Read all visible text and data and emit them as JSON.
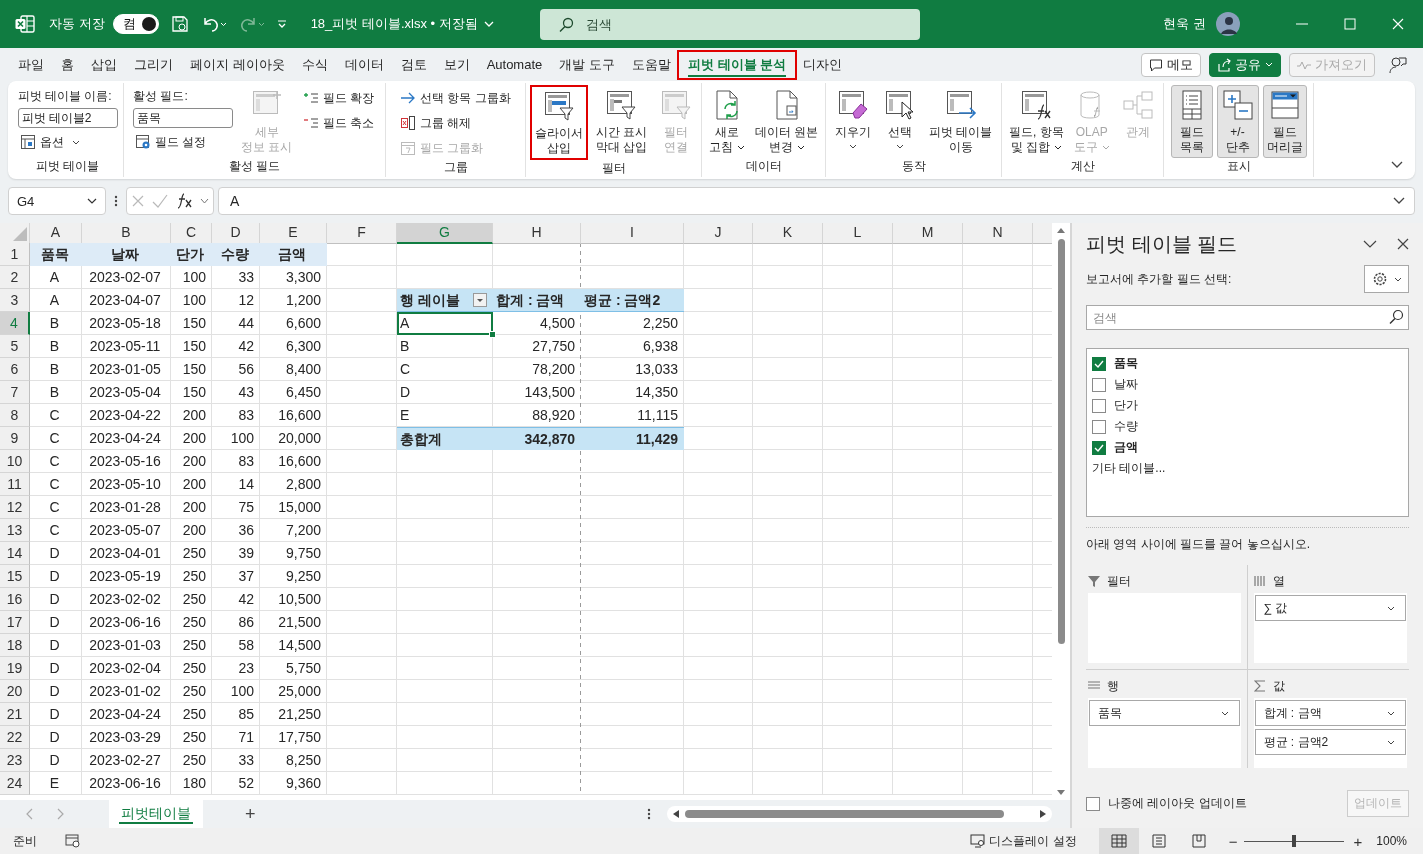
{
  "window": {
    "autosave_label": "자동 저장",
    "autosave": {
      "on": true,
      "label": "켬"
    },
    "title": "18_피벗 테이블.xlsx • 저장됨",
    "search_placeholder": "검색",
    "user_name": "현욱 권"
  },
  "menu_tabs": [
    {
      "label": "파일",
      "selected": false,
      "highlighted": false
    },
    {
      "label": "홈",
      "selected": false,
      "highlighted": false
    },
    {
      "label": "삽입",
      "selected": false,
      "highlighted": false
    },
    {
      "label": "그리기",
      "selected": false,
      "highlighted": false
    },
    {
      "label": "페이지 레이아웃",
      "selected": false,
      "highlighted": false
    },
    {
      "label": "수식",
      "selected": false,
      "highlighted": false
    },
    {
      "label": "데이터",
      "selected": false,
      "highlighted": false
    },
    {
      "label": "검토",
      "selected": false,
      "highlighted": false
    },
    {
      "label": "보기",
      "selected": false,
      "highlighted": false
    },
    {
      "label": "Automate",
      "selected": false,
      "highlighted": false
    },
    {
      "label": "개발 도구",
      "selected": false,
      "highlighted": false
    },
    {
      "label": "도움말",
      "selected": false,
      "highlighted": false
    },
    {
      "label": "피벗 테이블 분석",
      "selected": true,
      "highlighted": true
    },
    {
      "label": "디자인",
      "selected": false,
      "highlighted": false
    }
  ],
  "menu_buttons": [
    {
      "kind": "comments",
      "label": "메모",
      "disabled": false
    },
    {
      "kind": "share",
      "label": "공유",
      "disabled": false
    },
    {
      "kind": "catchup",
      "label": "가져오기",
      "disabled": true
    }
  ],
  "ribbon": [
    {
      "label": "피벗 테이블",
      "controls": [
        {
          "kind": "caption",
          "label": "피벗 테이블 이름:"
        },
        {
          "kind": "input",
          "value": "피벗 테이블2"
        },
        {
          "kind": "small",
          "label": "옵션",
          "dropdown": true,
          "disabled": false
        }
      ]
    },
    {
      "label": "활성 필드",
      "controls": [
        {
          "kind": "caption",
          "label": "활성 필드:"
        },
        {
          "kind": "input",
          "value": "품목"
        },
        {
          "kind": "small",
          "label": "필드 설정",
          "dropdown": false,
          "disabled": false
        },
        {
          "kind": "large",
          "lines": [
            "세부",
            "정보 표시"
          ],
          "dropdown": false,
          "disabled": true,
          "highlighted": false,
          "pressed": false
        },
        {
          "kind": "small",
          "label": "필드 확장",
          "dropdown": false,
          "disabled": false
        },
        {
          "kind": "small",
          "label": "필드 축소",
          "dropdown": false,
          "disabled": false
        }
      ]
    },
    {
      "label": "그룹",
      "controls": [
        {
          "kind": "small",
          "label": "선택 항목 그룹화",
          "dropdown": false,
          "disabled": false
        },
        {
          "kind": "small",
          "label": "그룹 해제",
          "dropdown": false,
          "disabled": false
        },
        {
          "kind": "small",
          "label": "필드 그룹화",
          "dropdown": false,
          "disabled": true
        }
      ]
    },
    {
      "label": "필터",
      "controls": [
        {
          "kind": "large",
          "lines": [
            "슬라이서",
            "삽입"
          ],
          "dropdown": false,
          "disabled": false,
          "highlighted": true,
          "pressed": false
        },
        {
          "kind": "large",
          "lines": [
            "시간 표시",
            "막대 삽입"
          ],
          "dropdown": false,
          "disabled": false,
          "highlighted": false,
          "pressed": false
        },
        {
          "kind": "large",
          "lines": [
            "필터",
            "연결"
          ],
          "dropdown": false,
          "disabled": true,
          "highlighted": false,
          "pressed": false
        }
      ]
    },
    {
      "label": "데이터",
      "controls": [
        {
          "kind": "large",
          "lines": [
            "새로",
            "고침"
          ],
          "dropdown": true,
          "disabled": false,
          "highlighted": false,
          "pressed": false
        },
        {
          "kind": "large",
          "lines": [
            "데이터 원본",
            "변경"
          ],
          "dropdown": true,
          "disabled": false,
          "highlighted": false,
          "pressed": false
        }
      ]
    },
    {
      "label": "동작",
      "controls": [
        {
          "kind": "large",
          "lines": [
            "지우기"
          ],
          "dropdown": true,
          "disabled": false,
          "highlighted": false,
          "pressed": false
        },
        {
          "kind": "large",
          "lines": [
            "선택"
          ],
          "dropdown": true,
          "disabled": false,
          "highlighted": false,
          "pressed": false
        },
        {
          "kind": "large",
          "lines": [
            "피벗 테이블",
            "이동"
          ],
          "dropdown": false,
          "disabled": false,
          "highlighted": false,
          "pressed": false
        }
      ]
    },
    {
      "label": "계산",
      "controls": [
        {
          "kind": "large",
          "lines": [
            "필드, 항목",
            "및 집합"
          ],
          "dropdown": true,
          "disabled": false,
          "highlighted": false,
          "pressed": false
        },
        {
          "kind": "large",
          "lines": [
            "OLAP",
            "도구"
          ],
          "dropdown": true,
          "disabled": true,
          "highlighted": false,
          "pressed": false
        },
        {
          "kind": "large",
          "lines": [
            "관계"
          ],
          "dropdown": false,
          "disabled": true,
          "highlighted": false,
          "pressed": false
        }
      ]
    },
    {
      "label": "표시",
      "controls": [
        {
          "kind": "large",
          "lines": [
            "필드",
            "목록"
          ],
          "dropdown": false,
          "disabled": false,
          "highlighted": false,
          "pressed": true
        },
        {
          "kind": "large",
          "lines": [
            "+/-",
            "단추"
          ],
          "dropdown": false,
          "disabled": false,
          "highlighted": false,
          "pressed": true
        },
        {
          "kind": "large",
          "lines": [
            "필드",
            "머리글"
          ],
          "dropdown": false,
          "disabled": false,
          "highlighted": false,
          "pressed": true
        }
      ]
    }
  ],
  "formula_bar": {
    "name_box": "G4",
    "formula": "A"
  },
  "sheet": {
    "column_headers": [
      {
        "label": "A",
        "selected": false
      },
      {
        "label": "B",
        "selected": false
      },
      {
        "label": "C",
        "selected": false
      },
      {
        "label": "D",
        "selected": false
      },
      {
        "label": "E",
        "selected": false
      },
      {
        "label": "F",
        "selected": false
      },
      {
        "label": "G",
        "selected": true
      },
      {
        "label": "H",
        "selected": false
      },
      {
        "label": "I",
        "selected": false
      },
      {
        "label": "J",
        "selected": false
      },
      {
        "label": "K",
        "selected": false
      },
      {
        "label": "L",
        "selected": false
      },
      {
        "label": "M",
        "selected": false
      },
      {
        "label": "N",
        "selected": false
      }
    ],
    "row_numbers": [
      {
        "label": "1",
        "selected": false
      },
      {
        "label": "2",
        "selected": false
      },
      {
        "label": "3",
        "selected": false
      },
      {
        "label": "4",
        "selected": true
      },
      {
        "label": "5",
        "selected": false
      },
      {
        "label": "6",
        "selected": false
      },
      {
        "label": "7",
        "selected": false
      },
      {
        "label": "8",
        "selected": false
      },
      {
        "label": "9",
        "selected": false
      },
      {
        "label": "10",
        "selected": false
      },
      {
        "label": "11",
        "selected": false
      },
      {
        "label": "12",
        "selected": false
      },
      {
        "label": "13",
        "selected": false
      },
      {
        "label": "14",
        "selected": false
      },
      {
        "label": "15",
        "selected": false
      },
      {
        "label": "16",
        "selected": false
      },
      {
        "label": "17",
        "selected": false
      },
      {
        "label": "18",
        "selected": false
      },
      {
        "label": "19",
        "selected": false
      },
      {
        "label": "20",
        "selected": false
      },
      {
        "label": "21",
        "selected": false
      },
      {
        "label": "22",
        "selected": false
      },
      {
        "label": "23",
        "selected": false
      },
      {
        "label": "24",
        "selected": false
      }
    ]
  },
  "data_table": {
    "header": [
      "품목",
      "날짜",
      "단가",
      "수량",
      "금액"
    ],
    "rows": [
      [
        "A",
        "2023-02-07",
        "100",
        "33",
        "3,300"
      ],
      [
        "A",
        "2023-04-07",
        "100",
        "12",
        "1,200"
      ],
      [
        "B",
        "2023-05-18",
        "150",
        "44",
        "6,600"
      ],
      [
        "B",
        "2023-05-11",
        "150",
        "42",
        "6,300"
      ],
      [
        "B",
        "2023-01-05",
        "150",
        "56",
        "8,400"
      ],
      [
        "B",
        "2023-05-04",
        "150",
        "43",
        "6,450"
      ],
      [
        "C",
        "2023-04-22",
        "200",
        "83",
        "16,600"
      ],
      [
        "C",
        "2023-04-24",
        "200",
        "100",
        "20,000"
      ],
      [
        "C",
        "2023-05-16",
        "200",
        "83",
        "16,600"
      ],
      [
        "C",
        "2023-05-10",
        "200",
        "14",
        "2,800"
      ],
      [
        "C",
        "2023-01-28",
        "200",
        "75",
        "15,000"
      ],
      [
        "C",
        "2023-05-07",
        "200",
        "36",
        "7,200"
      ],
      [
        "D",
        "2023-04-01",
        "250",
        "39",
        "9,750"
      ],
      [
        "D",
        "2023-05-19",
        "250",
        "37",
        "9,250"
      ],
      [
        "D",
        "2023-02-02",
        "250",
        "42",
        "10,500"
      ],
      [
        "D",
        "2023-06-16",
        "250",
        "86",
        "21,500"
      ],
      [
        "D",
        "2023-01-03",
        "250",
        "58",
        "14,500"
      ],
      [
        "D",
        "2023-02-04",
        "250",
        "23",
        "5,750"
      ],
      [
        "D",
        "2023-01-02",
        "250",
        "100",
        "25,000"
      ],
      [
        "D",
        "2023-04-24",
        "250",
        "85",
        "21,250"
      ],
      [
        "D",
        "2023-03-29",
        "250",
        "71",
        "17,750"
      ],
      [
        "D",
        "2023-02-27",
        "250",
        "33",
        "8,250"
      ],
      [
        "E",
        "2023-06-16",
        "180",
        "52",
        "9,360"
      ]
    ]
  },
  "pivot_table": {
    "header": [
      "행 레이블",
      "합계 : 금액",
      "평균 : 금액2"
    ],
    "rows": [
      {
        "cells": [
          "A",
          "4,500",
          "2,250"
        ],
        "selected": true
      },
      {
        "cells": [
          "B",
          "27,750",
          "6,938"
        ],
        "selected": false
      },
      {
        "cells": [
          "C",
          "78,200",
          "13,033"
        ],
        "selected": false
      },
      {
        "cells": [
          "D",
          "143,500",
          "14,350"
        ],
        "selected": false
      },
      {
        "cells": [
          "E",
          "88,920",
          "11,115"
        ],
        "selected": false
      }
    ],
    "total": [
      "총합계",
      "342,870",
      "11,429"
    ]
  },
  "sheet_tabs": [
    {
      "label": "피벗테이블",
      "selected": true
    }
  ],
  "add_sheet": "+",
  "pane": {
    "title": "피벗 테이블 필드",
    "subtitle": "보고서에 추가할 필드 선택:",
    "search_placeholder": "검색",
    "fields": [
      {
        "label": "품목",
        "checked": true
      },
      {
        "label": "날짜",
        "checked": false
      },
      {
        "label": "단가",
        "checked": false
      },
      {
        "label": "수량",
        "checked": false
      },
      {
        "label": "금액",
        "checked": true
      }
    ],
    "more_tables": "기타 테이블...",
    "drag_hint": "아래 영역 사이에 필드를 끌어 놓으십시오.",
    "areas": [
      {
        "kind": "filters",
        "label": "필터"
      },
      {
        "kind": "columns",
        "label": "열",
        "items": [
          "∑ 값"
        ]
      },
      {
        "kind": "rows",
        "label": "행",
        "items": [
          "품목"
        ]
      },
      {
        "kind": "values",
        "label": "값",
        "items": [
          "합계 : 금액",
          "평균 : 금액2"
        ]
      }
    ],
    "defer_update": {
      "label": "나중에 레이아웃 업데이트",
      "checked": false
    },
    "update_button": {
      "label": "업데이트",
      "disabled": true
    }
  },
  "status_bar": {
    "status": "준비",
    "display_settings": "디스플레이 설정",
    "views": [
      {
        "selected": true
      },
      {
        "selected": false
      },
      {
        "selected": false
      }
    ],
    "zoom_out": "−",
    "zoom": {
      "level": 0.5
    },
    "zoom_in": "+",
    "zoom_label": "100%"
  }
}
